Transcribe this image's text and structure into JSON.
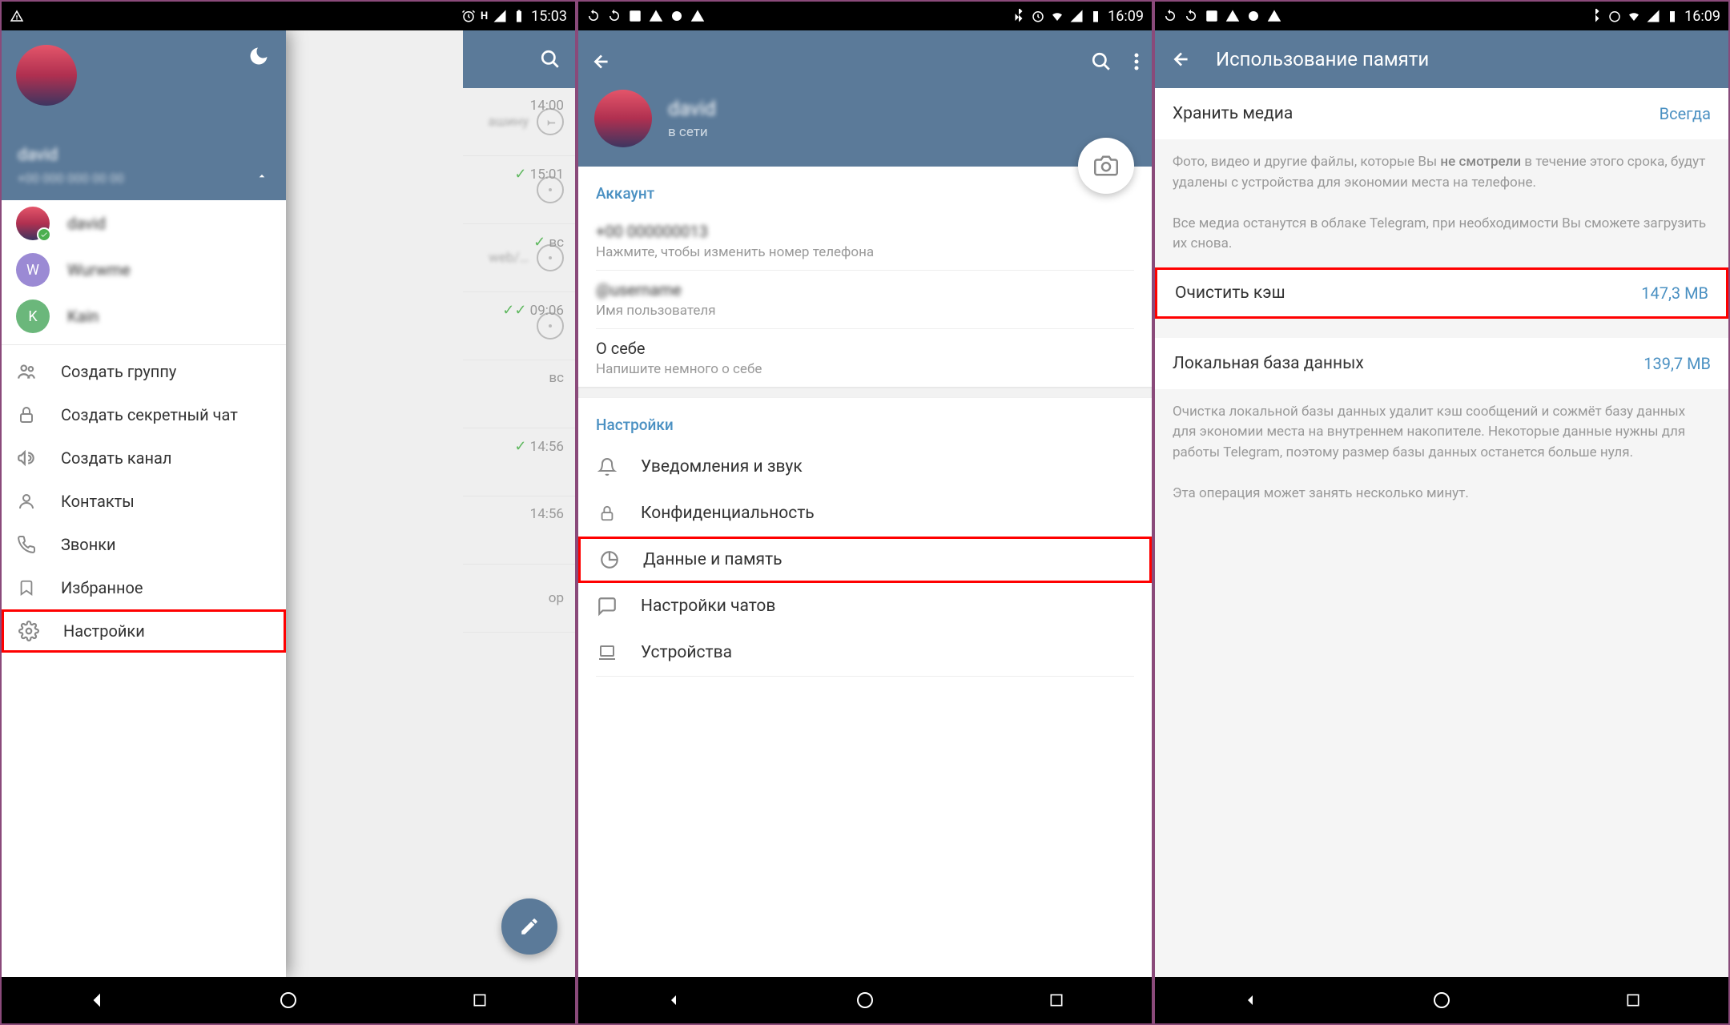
{
  "statusbar": {
    "time1": "15:03",
    "time2": "16:09",
    "time3": "16:09"
  },
  "screen1": {
    "drawer": {
      "accounts": [
        {
          "letter": "",
          "name": "david"
        },
        {
          "letter": "W",
          "name": "Wurwme"
        },
        {
          "letter": "K",
          "name": "Kain"
        }
      ],
      "items": {
        "create_group": "Создать группу",
        "secret_chat": "Создать секретный чат",
        "create_channel": "Создать канал",
        "contacts": "Контакты",
        "calls": "Звонки",
        "saved": "Избранное",
        "settings": "Настройки"
      }
    },
    "chats": {
      "t0": "14:00",
      "snip0": "ашину",
      "t1": "15:01",
      "t2": "вс",
      "snip2": "web/…",
      "t3": "09:06",
      "t4": "вс",
      "t5": "14:56",
      "t6": "14:56",
      "snip7": "ор"
    }
  },
  "screen2": {
    "name": "david",
    "status": "в сети",
    "account_header": "Аккаунт",
    "phone_blur": "+00 000000013",
    "phone_hint": "Нажмите, чтобы изменить номер телефона",
    "username_blur": "@username",
    "username_hint": "Имя пользователя",
    "bio_label": "О себе",
    "bio_hint": "Напишите немного о себе",
    "settings_header": "Настройки",
    "items": {
      "notifications": "Уведомления и звук",
      "privacy": "Конфиденциальность",
      "data": "Данные и память",
      "chat_settings": "Настройки чатов",
      "devices": "Устройства"
    }
  },
  "screen3": {
    "title": "Использование памяти",
    "keep_media_label": "Хранить медиа",
    "keep_media_value": "Всегда",
    "desc1a": "Фото, видео и другие файлы, которые Вы ",
    "desc1b": "не смотрели",
    "desc1c": " в течение этого срока, будут удалены с устройства для экономии места на телефоне.",
    "desc1d": "Все медиа останутся в облаке Telegram, при необходимости Вы сможете загрузить их снова.",
    "clear_cache_label": "Очистить кэш",
    "clear_cache_value": "147,3 MB",
    "local_db_label": "Локальная база данных",
    "local_db_value": "139,7 MB",
    "desc2a": "Очистка локальной базы данных удалит кэш сообщений и сожмёт базу данных для экономии места на внутреннем накопителе. Некоторые данные нужны для работы Telegram, поэтому размер базы данных останется больше нуля.",
    "desc2b": "Эта операция может занять несколько минут."
  }
}
